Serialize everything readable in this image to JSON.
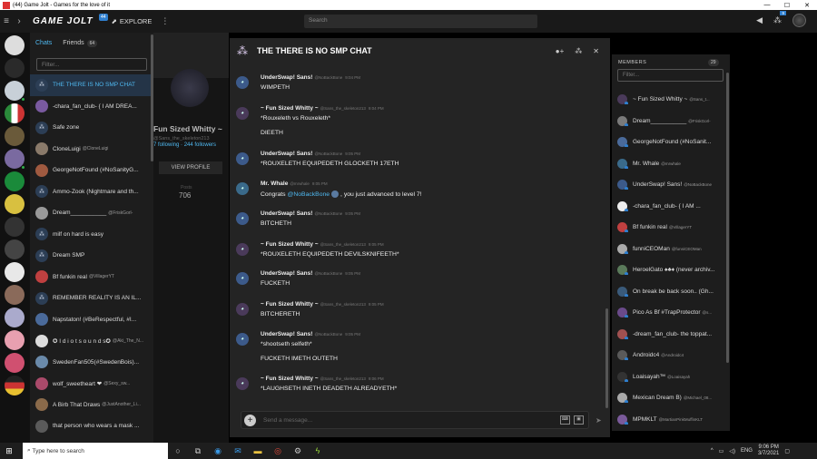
{
  "window": {
    "title": "(44) Game Jolt - Games for the love of it",
    "min": "—",
    "max": "☐",
    "close": "✕"
  },
  "topbar": {
    "logo": "GAME JOLT",
    "logo_badge": "44",
    "explore": "EXPLORE",
    "search_placeholder": "Search",
    "notif_badge": "9"
  },
  "chats_panel": {
    "tab_chats": "Chats",
    "tab_friends": "Friends",
    "friends_count": "64",
    "filter_placeholder": "Filter...",
    "items": [
      {
        "name": "THE THERE IS NO SMP CHAT",
        "sub": "",
        "group": true,
        "active": true
      },
      {
        "name": "-chara_fan_club- { I AM DREA...",
        "sub": "",
        "group": false
      },
      {
        "name": "Safe zone",
        "sub": "",
        "group": true
      },
      {
        "name": "CloneLuigi",
        "sub": "@CloneLuigi",
        "group": false
      },
      {
        "name": "GeorgeNotFound (#NoSanityG...",
        "sub": "",
        "group": false
      },
      {
        "name": "Ammo-Zook (Nightmare and th...",
        "sub": "",
        "group": true
      },
      {
        "name": "Dream___________",
        "sub": "@FriskGorl-",
        "group": false
      },
      {
        "name": "milf on hard is easy",
        "sub": "",
        "group": true
      },
      {
        "name": "Dream SMP",
        "sub": "",
        "group": true
      },
      {
        "name": "Bf funkin real",
        "sub": "@VillagerYT",
        "group": false
      },
      {
        "name": "REMEMBER REALITY IS AN IL...",
        "sub": "",
        "group": true
      },
      {
        "name": "Napstaton! (#BeRespectful, #I...",
        "sub": "",
        "group": false
      },
      {
        "name": "✪ I d i o t s o u n d s✪",
        "sub": "@Aki_The_N...",
        "group": false
      },
      {
        "name": "SwedenFan505(#SwedenBois)...",
        "sub": "",
        "group": false
      },
      {
        "name": "wolf_sweetheart ❤",
        "sub": "@Sexy_sw...",
        "group": false
      },
      {
        "name": "A Birb That Draws",
        "sub": "@JustAnother_Li...",
        "group": false
      },
      {
        "name": "that person who wears a mask ...",
        "sub": "",
        "group": false
      }
    ]
  },
  "profile": {
    "name": "Fun Sized Whitty ~",
    "handle": "@Sans_the_skeleton213",
    "following": "7 following",
    "followers": "244 followers",
    "view_btn": "VIEW PROFILE",
    "stat_label": "Posts",
    "stat_value": "706"
  },
  "chat": {
    "title": "THE THERE IS NO SMP CHAT",
    "composer_placeholder": "Send a message...",
    "messages": [
      {
        "name": "UnderSwap! Sans!",
        "handle": "@NoBackBone",
        "time": "9:04 PM",
        "lines": [
          "WIMPETH"
        ]
      },
      {
        "name": "~ Fun Sized Whitty ~",
        "handle": "@Sans_the_skeleton213",
        "time": "9:04 PM",
        "lines": [
          "*Rouxeleth vs Rouxeleth*",
          "DIEETH"
        ]
      },
      {
        "name": "UnderSwap! Sans!",
        "handle": "@NoBackBone",
        "time": "9:05 PM",
        "lines": [
          "*ROUXELETH EQUIPEDETH GLOCKETH 17ETH"
        ]
      },
      {
        "name": "Mr. Whale",
        "handle": "@mrwhale",
        "time": "9:05 PM",
        "level": {
          "pre": "Congrats ",
          "mention": "@NoBackBone",
          "post": ", you just advanced to level 7!"
        }
      },
      {
        "name": "UnderSwap! Sans!",
        "handle": "@NoBackBone",
        "time": "9:05 PM",
        "lines": [
          "BITCHETH"
        ]
      },
      {
        "name": "~ Fun Sized Whitty ~",
        "handle": "@Sans_the_skeleton213",
        "time": "9:05 PM",
        "lines": [
          "*ROUXELETH EQUIPEDETH DEVILSKNIFEETH*"
        ]
      },
      {
        "name": "UnderSwap! Sans!",
        "handle": "@NoBackBone",
        "time": "9:05 PM",
        "lines": [
          "FUCKETH"
        ]
      },
      {
        "name": "~ Fun Sized Whitty ~",
        "handle": "@Sans_the_skeleton213",
        "time": "9:05 PM",
        "lines": [
          "BITCHERETH"
        ]
      },
      {
        "name": "UnderSwap! Sans!",
        "handle": "@NoBackBone",
        "time": "9:05 PM",
        "lines": [
          "*shootseth selfeth*",
          "FUCKETH IMETH OUTETH"
        ]
      },
      {
        "name": "~ Fun Sized Whitty ~",
        "handle": "@Sans_the_skeleton213",
        "time": "9:06 PM",
        "lines": [
          "*LAUGHSETH INETH DEADETH ALREADYETH*"
        ]
      }
    ]
  },
  "members": {
    "header": "MEMBERS",
    "count": "29",
    "filter_placeholder": "Filter...",
    "items": [
      {
        "name": "~ Fun Sized Whitty ~",
        "sub": "@Sans_t..."
      },
      {
        "name": "Dream___________",
        "sub": "@FriskGorl-"
      },
      {
        "name": "GeorgeNotFound (#NoSanit...",
        "sub": ""
      },
      {
        "name": "Mr. Whale",
        "sub": "@mrwhale"
      },
      {
        "name": "UnderSwap! Sans!",
        "sub": "@NoBackBone"
      },
      {
        "name": "-chara_fan_club- { I AM ...",
        "sub": ""
      },
      {
        "name": "Bf funkin real",
        "sub": "@VillagerYT"
      },
      {
        "name": "funniCEOMan",
        "sub": "@funniCEOMan"
      },
      {
        "name": "HeroelGato ♠♣♦ (never archiv...",
        "sub": ""
      },
      {
        "name": "On break be back soon.. (Gh...",
        "sub": ""
      },
      {
        "name": "Pico As Bf #TrapProtector",
        "sub": "@s..."
      },
      {
        "name": "-dream_fan_club- the toppat...",
        "sub": ""
      },
      {
        "name": "Androidc4",
        "sub": "@Androidc4"
      },
      {
        "name": "Loaisayah™",
        "sub": "@Loaisayah"
      },
      {
        "name": "Mexican Dream B)",
        "sub": "@Michael_08..."
      },
      {
        "name": "MPMKLT",
        "sub": "@MartianPinkMuffinKLT"
      }
    ]
  },
  "taskbar": {
    "search": "Type here to search",
    "lang": "ENG",
    "time": "9:06 PM",
    "date": "3/7/2021"
  }
}
